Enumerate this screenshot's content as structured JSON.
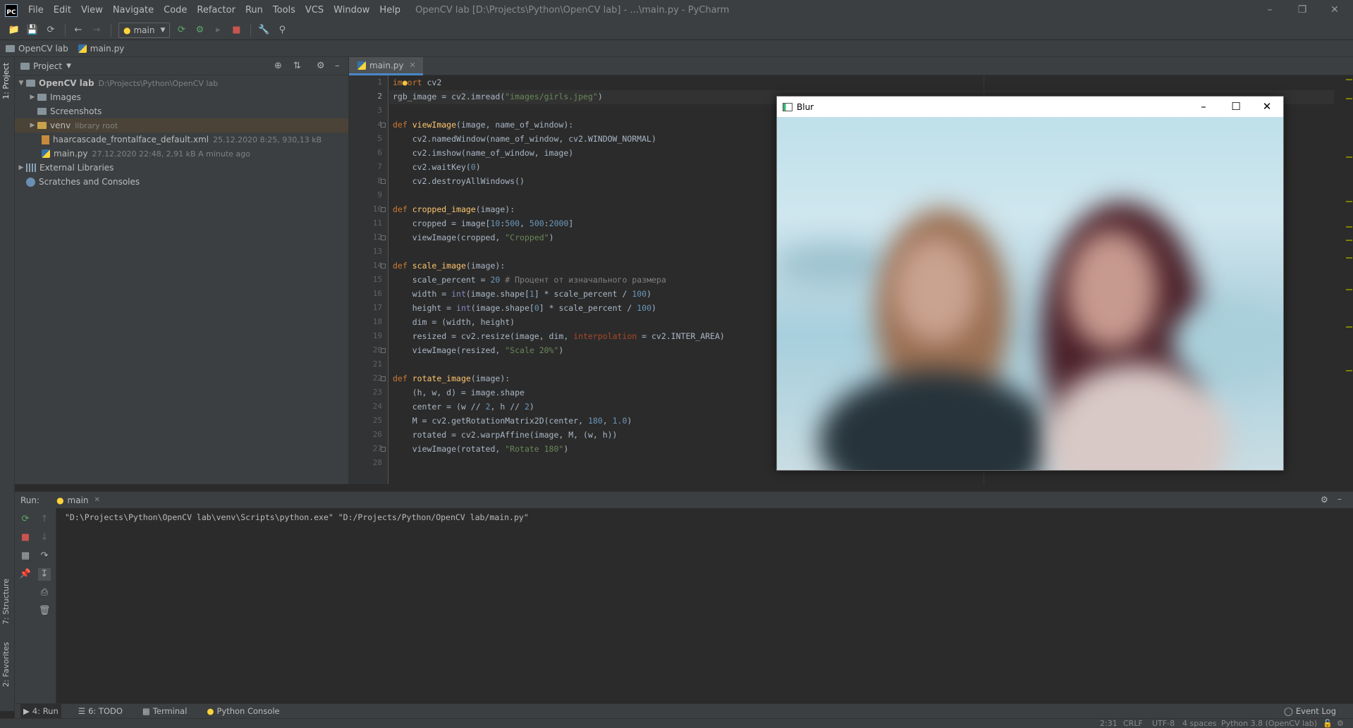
{
  "menubar": {
    "items": [
      "File",
      "Edit",
      "View",
      "Navigate",
      "Code",
      "Refactor",
      "Run",
      "Tools",
      "VCS",
      "Window",
      "Help"
    ],
    "title": "OpenCV lab [D:\\Projects\\Python\\OpenCV lab] - ...\\main.py - PyCharm"
  },
  "toolbar": {
    "run_config": "main"
  },
  "breadcrumb": {
    "project": "OpenCV lab",
    "file": "main.py"
  },
  "left_stripe": {
    "project_tab": "1: Project",
    "structure_tab": "7: Structure",
    "favorites_tab": "2: Favorites"
  },
  "project_panel": {
    "title": "Project",
    "tree": {
      "root_name": "OpenCV lab",
      "root_path": "D:\\Projects\\Python\\OpenCV lab",
      "images": "Images",
      "screenshots": "Screenshots",
      "venv": "venv",
      "venv_note": "library root",
      "haar_name": "haarcascade_frontalface_default.xml",
      "haar_meta": "25.12.2020 8:25, 930,13 kB",
      "main_name": "main.py",
      "main_meta": "27.12.2020 22:48, 2,91 kB A minute ago",
      "external": "External Libraries",
      "scratches": "Scratches and Consoles"
    }
  },
  "editor": {
    "tab_label": "main.py",
    "line_numbers": [
      "1",
      "2",
      "3",
      "4",
      "5",
      "6",
      "7",
      "8",
      "9",
      "10",
      "11",
      "12",
      "13",
      "14",
      "15",
      "16",
      "17",
      "18",
      "19",
      "20",
      "21",
      "22",
      "23",
      "24",
      "25",
      "26",
      "27",
      "28"
    ]
  },
  "blur_window": {
    "title": "Blur"
  },
  "run_panel": {
    "label": "Run:",
    "tab": "main",
    "console_output": "\"D:\\Projects\\Python\\OpenCV lab\\venv\\Scripts\\python.exe\" \"D:/Projects/Python/OpenCV lab/main.py\""
  },
  "bottom_tools": {
    "run": "4: Run",
    "todo": "6: TODO",
    "terminal": "Terminal",
    "python_console": "Python Console",
    "event_log": "Event Log"
  },
  "statusbar": {
    "position": "2:31",
    "line_sep": "CRLF",
    "encoding": "UTF-8",
    "indent": "4 spaces",
    "interpreter": "Python 3.8 (OpenCV lab)"
  }
}
